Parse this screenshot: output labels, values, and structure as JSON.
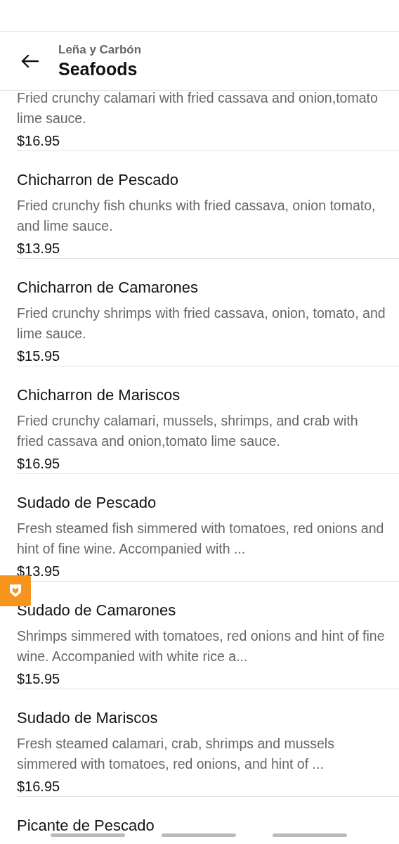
{
  "header": {
    "restaurant": "Leña y Carbón",
    "title": "Seafoods"
  },
  "items": [
    {
      "description": "Fried crunchy calamari with fried cassava and onion,tomato lime sauce.",
      "price": "$16.95"
    },
    {
      "name": "Chicharron de Pescado",
      "description": "Fried crunchy fish chunks with fried cassava, onion tomato, and lime sauce.",
      "price": "$13.95"
    },
    {
      "name": "Chicharron de Camarones",
      "description": "Fried crunchy shrimps with fried cassava, onion, tomato, and lime sauce.",
      "price": "$15.95"
    },
    {
      "name": "Chicharron de Mariscos",
      "description": "Fried crunchy calamari, mussels, shrimps, and crab with fried cassava and onion,tomato lime sauce.",
      "price": "$16.95"
    },
    {
      "name": "Sudado de Pescado",
      "description": "Fresh steamed fish simmered with tomatoes, red onions and hint of fine wine. Accompanied with ...",
      "price": "$13.95"
    },
    {
      "name": "Sudado de Camarones",
      "description": "Shrimps simmered with tomatoes, red onions and hint of fine wine. Accompanied with white rice a...",
      "price": "$15.95"
    },
    {
      "name": "Sudado de Mariscos",
      "description": "Fresh steamed calamari, crab, shrimps and mussels simmered with tomatoes, red onions, and hint of ...",
      "price": "$16.95"
    },
    {
      "name": "Picante de Pescado"
    }
  ]
}
